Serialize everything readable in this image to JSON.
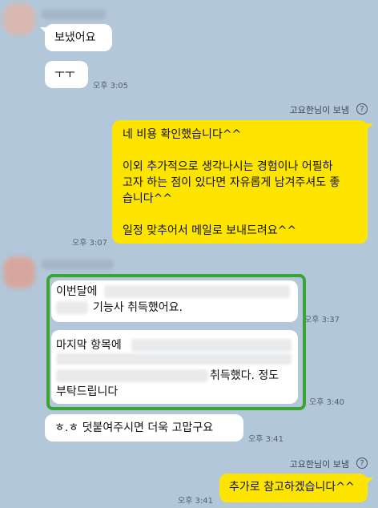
{
  "colors": {
    "background": "#b2c7da",
    "my_bubble": "#fee500",
    "other_bubble": "#ffffff",
    "highlight": "#3aa535"
  },
  "messages": {
    "m1": {
      "text": "보냈어요"
    },
    "m2": {
      "text": "ㅜㅜ",
      "time": "오후 3:05"
    },
    "m3": {
      "sender": "고요한님이 보냄",
      "lines": [
        "네 비용 확인했습니다^^",
        "이외 추가적으로 생각나시는 경험이나 어필하",
        "고자 하는 점이 있다면 자유롭게 남겨주셔도 좋",
        "습니다^^",
        "일정 맞추어서 메일로 보내드려요^^"
      ],
      "time": "오후 3:07"
    },
    "m4": {
      "line1": "이번달에",
      "line2": "기능사 취득했어요.",
      "time": "오후 3:37"
    },
    "m5": {
      "line1": "마지막 항목에",
      "line3": "취득했다. 정도",
      "line4": "부탁드립니다",
      "time": "오후 3:40"
    },
    "m6": {
      "text": "ㅎ.ㅎ 덧붙여주시면 더욱 고맙구요",
      "time": "오후 3:41"
    },
    "m7": {
      "sender": "고요한님이 보냄",
      "text": "추가로 참고하겠습니다^^",
      "time": "오후 3:41"
    }
  },
  "icons": {
    "help": "?"
  }
}
